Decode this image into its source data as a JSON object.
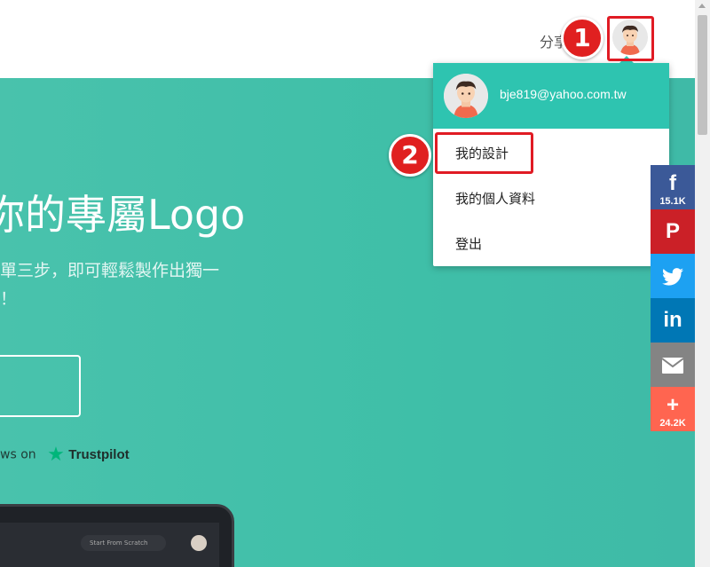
{
  "topbar": {
    "share_text": "分享"
  },
  "hero": {
    "title": "你的專屬Logo",
    "subtitle_line1": "單三步，即可輕鬆製作出獨一",
    "subtitle_line2": "！",
    "reviews_text": "ws on",
    "trustpilot_label": "Trustpilot"
  },
  "laptop": {
    "start_button": "Start From Scratch"
  },
  "annotations": {
    "badge1": "1",
    "badge2": "2",
    "highlight_color": "#e01b24"
  },
  "account_menu": {
    "email": "bje819@yahoo.com.tw",
    "items": [
      {
        "label": "我的設計"
      },
      {
        "label": "我的個人資料"
      },
      {
        "label": "登出"
      }
    ],
    "header_color": "#2ec4b0"
  },
  "share_bar": {
    "buttons": [
      {
        "network": "facebook",
        "icon": "f",
        "count": "15.1K",
        "color": "#3b5998"
      },
      {
        "network": "pinterest",
        "icon": "P",
        "count": "",
        "color": "#cb2027"
      },
      {
        "network": "twitter",
        "icon": "t",
        "count": "",
        "color": "#1da1f2"
      },
      {
        "network": "linkedin",
        "icon": "in",
        "count": "",
        "color": "#0077b5"
      },
      {
        "network": "email",
        "icon": "✉",
        "count": "",
        "color": "#848484"
      },
      {
        "network": "more",
        "icon": "+",
        "count": "24.2K",
        "color": "#ff6550"
      }
    ]
  },
  "colors": {
    "hero_bg": "#45c1ab",
    "accent": "#2ec4b0"
  }
}
